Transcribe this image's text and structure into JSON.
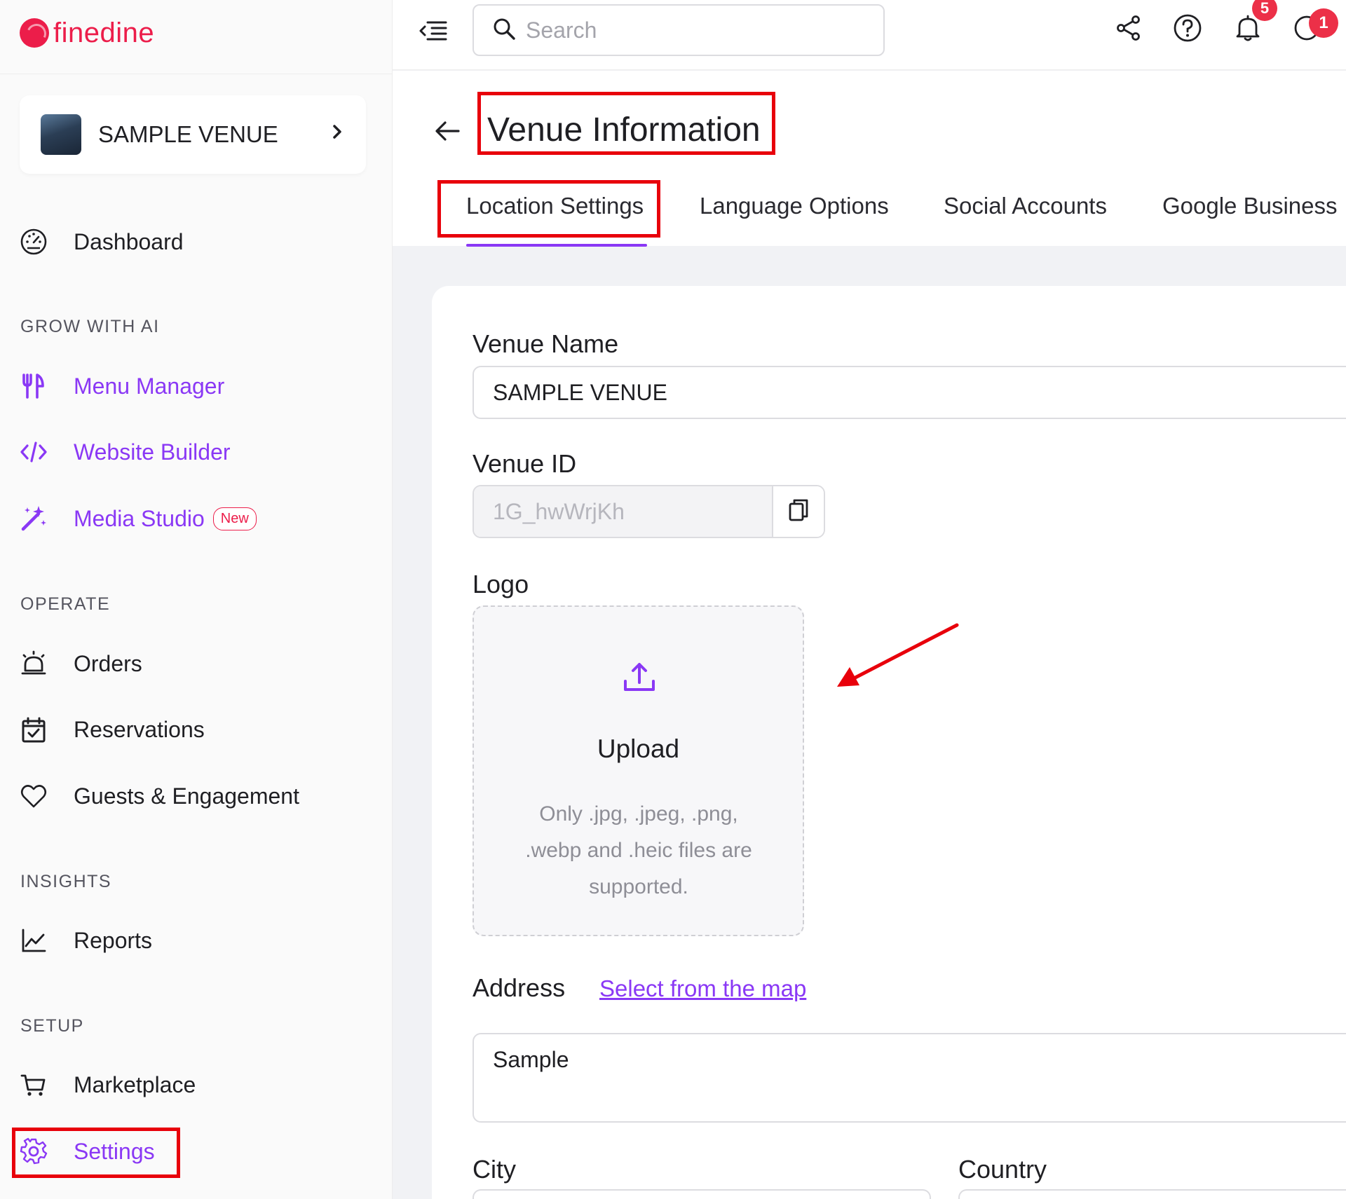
{
  "app": {
    "name": "finedine"
  },
  "venue_switcher": {
    "name": "SAMPLE VENUE"
  },
  "sidebar": {
    "dashboard": "Dashboard",
    "sections": {
      "grow": "GROW WITH AI",
      "operate": "OPERATE",
      "insights": "INSIGHTS",
      "setup": "SETUP"
    },
    "grow_items": [
      "Menu Manager",
      "Website Builder",
      "Media Studio"
    ],
    "new_badge": "New",
    "operate_items": [
      "Orders",
      "Reservations",
      "Guests & Engagement"
    ],
    "insights_items": [
      "Reports"
    ],
    "setup_items": [
      "Marketplace",
      "Settings"
    ],
    "accent_color": "#8a38f5"
  },
  "topbar": {
    "search_placeholder": "Search",
    "notification_count": "5",
    "profile_count": "1"
  },
  "page": {
    "title": "Venue Information",
    "tabs": [
      "Location Settings",
      "Language Options",
      "Social Accounts",
      "Google Business"
    ],
    "active_tab": "Location Settings"
  },
  "form": {
    "venue_name_label": "Venue Name",
    "venue_name_value": "SAMPLE VENUE",
    "venue_id_label": "Venue ID",
    "venue_id_value": "1G_hwWrjKh",
    "logo_label": "Logo",
    "upload_title": "Upload",
    "upload_hint": "Only .jpg, .jpeg, .png, .webp and .heic files are supported.",
    "address_label": "Address",
    "map_link": "Select from the map",
    "address_value": "Sample",
    "city_label": "City",
    "country_label": "Country"
  },
  "highlight_color": "#e8000b"
}
